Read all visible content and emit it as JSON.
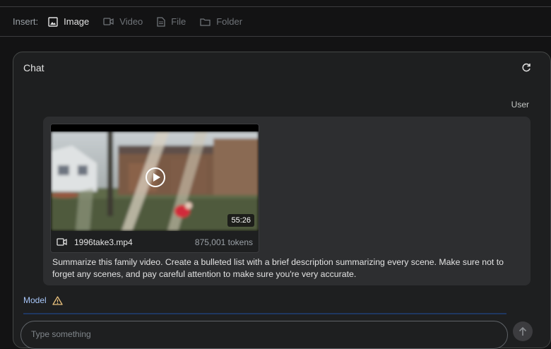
{
  "insert_bar": {
    "label": "Insert:",
    "items": [
      {
        "label": "Image",
        "icon": "image-icon",
        "active": true
      },
      {
        "label": "Video",
        "icon": "video-icon",
        "active": false
      },
      {
        "label": "File",
        "icon": "file-icon",
        "active": false
      },
      {
        "label": "Folder",
        "icon": "folder-icon",
        "active": false
      }
    ]
  },
  "chat": {
    "title": "Chat",
    "refresh_icon": "refresh-icon",
    "user_role": "User",
    "video": {
      "filename": "1996take3.mp4",
      "tokens": "875,001 tokens",
      "duration": "55:26"
    },
    "prompt": "Summarize this family video. Create a bulleted list with a brief description summarizing every scene. Make sure not to forget any scenes, and pay careful attention to make sure you're very accurate.",
    "model_role": "Model",
    "warning_icon": "warning-icon",
    "input_placeholder": "Type something",
    "send_icon": "send-icon"
  },
  "colors": {
    "background": "#131314",
    "panel": "#1e1f20",
    "bubble": "#2d2e30",
    "accent": "#a8c7fa"
  }
}
